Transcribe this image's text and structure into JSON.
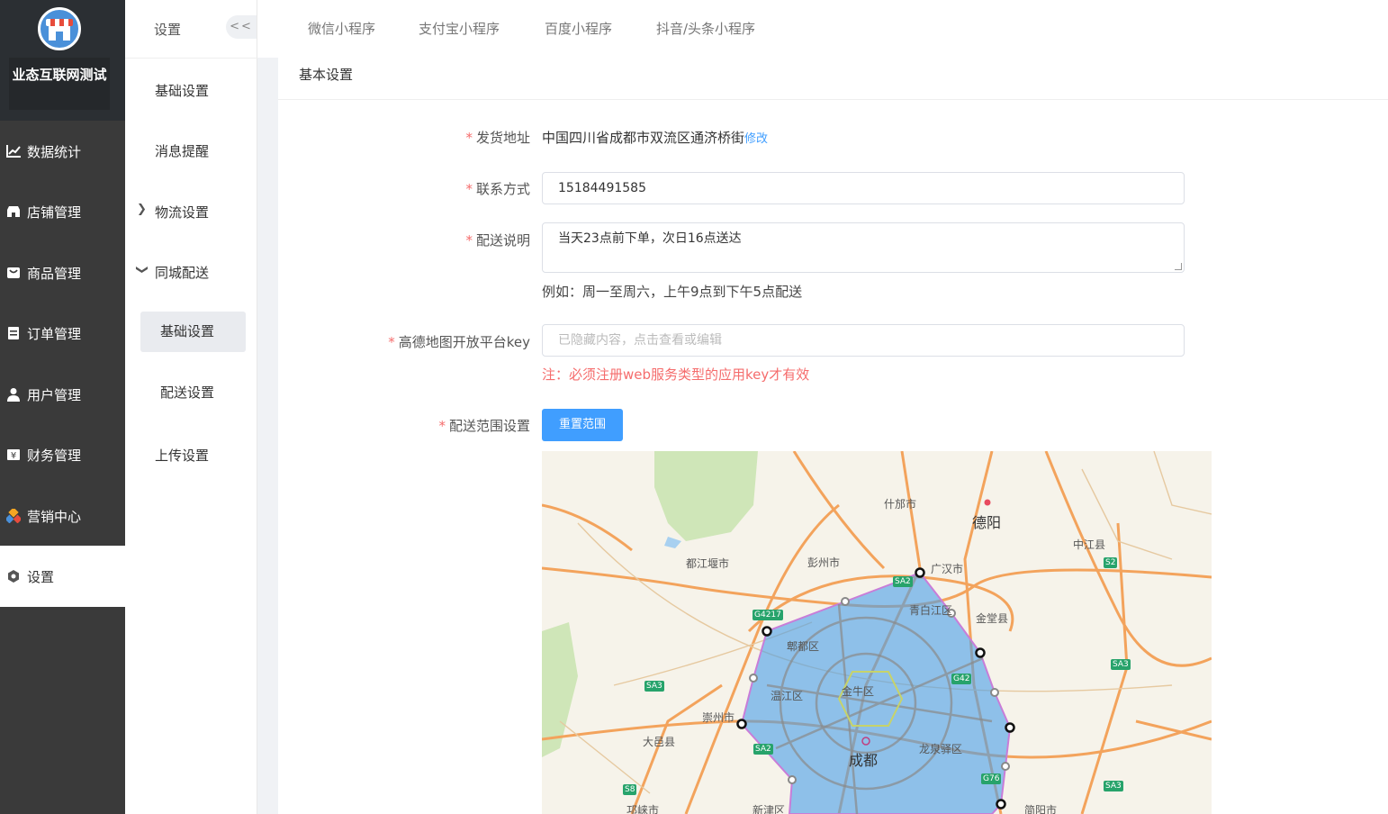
{
  "brand": {
    "name": "业态互联网测试"
  },
  "nav": [
    {
      "label": "数据统计",
      "icon": "chart-icon"
    },
    {
      "label": "店铺管理",
      "icon": "store-icon"
    },
    {
      "label": "商品管理",
      "icon": "goods-icon"
    },
    {
      "label": "订单管理",
      "icon": "order-icon"
    },
    {
      "label": "用户管理",
      "icon": "user-icon"
    },
    {
      "label": "财务管理",
      "icon": "finance-icon"
    },
    {
      "label": "营销中心",
      "icon": "marketing-icon"
    },
    {
      "label": "设置",
      "icon": "settings-icon"
    }
  ],
  "submenu": {
    "title": "设置",
    "collapse": "<<",
    "items": [
      "基础设置",
      "消息提醒",
      "物流设置",
      "同城配送"
    ],
    "children": [
      "基础设置",
      "配送设置"
    ],
    "upload": "上传设置"
  },
  "tabs": [
    "微信小程序",
    "支付宝小程序",
    "百度小程序",
    "抖音/头条小程序"
  ],
  "section_title": "基本设置",
  "form": {
    "address_label": "发货地址",
    "address_value": "中国四川省成都市双流区通济桥街",
    "address_edit": "修改",
    "contact_label": "联系方式",
    "contact_value": "15184491585",
    "desc_label": "配送说明",
    "desc_value": "当天23点前下单，次日16点送达",
    "desc_hint": "例如：周一至周六，上午9点到下午5点配送",
    "key_label": "高德地图开放平台key",
    "key_placeholder": "已隐藏内容，点击查看或编辑",
    "key_warning": "注：必须注册web服务类型的应用key才有效",
    "range_label": "配送范围设置",
    "reset_button": "重置范围",
    "required_mark": "*"
  },
  "map": {
    "labels": [
      "德阳",
      "什邡市",
      "中江县",
      "都江堰市",
      "彭州市",
      "广汉市",
      "青白江区",
      "金堂县",
      "郫都区",
      "温江区",
      "金牛区",
      "崇州市",
      "大邑县",
      "成都",
      "龙泉驿区",
      "新津区",
      "邛崃市",
      "简阳市"
    ],
    "shields": [
      "SA2",
      "G4217",
      "G42",
      "SA3",
      "SA3",
      "S2",
      "SA2",
      "G76",
      "S8",
      "SA3"
    ],
    "polygon_color": "#4a9fe8"
  }
}
